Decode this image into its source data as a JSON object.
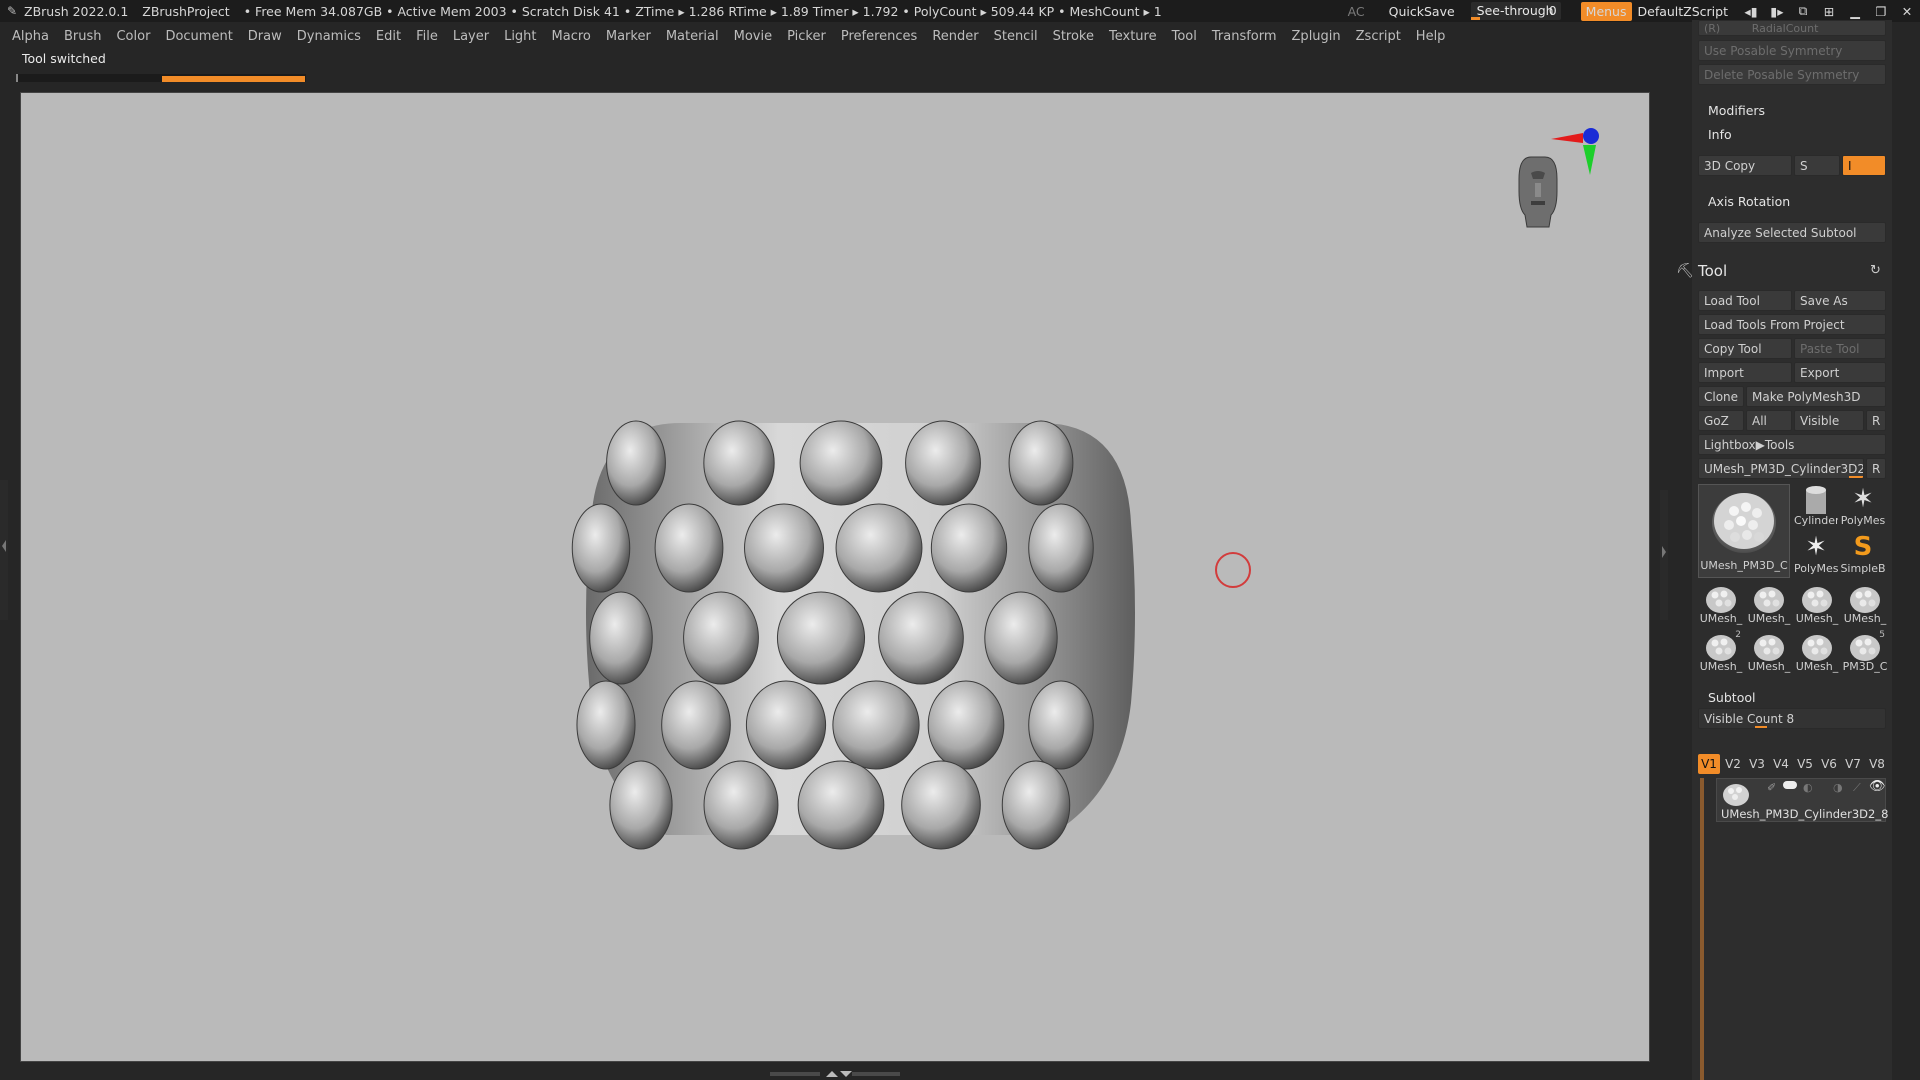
{
  "titlebar": {
    "app": "ZBrush 2022.0.1",
    "project": "ZBrushProject",
    "stats": "• Free Mem 34.087GB • Active Mem 2003 • Scratch Disk 41 • ZTime ▸ 1.286 RTime ▸ 1.89 Timer ▸ 1.792 • PolyCount ▸ 509.44 KP • MeshCount ▸ 1",
    "ac": "AC",
    "quicksave": "QuickSave",
    "see_through_label": "See-through",
    "see_through_value": "0",
    "see_through_fraction": 0.1,
    "menus": "Menus",
    "default_zscript": "DefaultZScript"
  },
  "menubar": [
    "Alpha",
    "Brush",
    "Color",
    "Document",
    "Draw",
    "Dynamics",
    "Edit",
    "File",
    "Layer",
    "Light",
    "Macro",
    "Marker",
    "Material",
    "Movie",
    "Picker",
    "Preferences",
    "Render",
    "Stencil",
    "Stroke",
    "Texture",
    "Tool",
    "Transform",
    "Zplugin",
    "Zscript",
    "Help"
  ],
  "notification": {
    "text": "Tool switched",
    "progress_fraction": 0.5
  },
  "panel": {
    "radial_count": "RadialCount",
    "radial_prefix": "(R)",
    "use_posable_symmetry": "Use Posable Symmetry",
    "delete_posable_symmetry": "Delete Posable Symmetry",
    "modifiers": "Modifiers",
    "info": "Info",
    "copy3d": "3D Copy",
    "copy3d_s": "S",
    "copy3d_i": "I",
    "axis_rotation": "Axis Rotation",
    "analyze": "Analyze Selected Subtool",
    "tool_header": "Tool",
    "load_tool": "Load Tool",
    "save_as": "Save As",
    "load_tools_from_project": "Load Tools From Project",
    "copy_tool": "Copy Tool",
    "paste_tool": "Paste Tool",
    "import": "Import",
    "export": "Export",
    "clone": "Clone",
    "make_polymesh": "Make PolyMesh3D",
    "goz": "GoZ",
    "all": "All",
    "visible": "Visible",
    "r": "R",
    "lightbox_tools": "Lightbox▶Tools",
    "current_tool_name": "UMesh_PM3D_Cylinder3D2_8",
    "current_tool_r": "R",
    "thumbs": {
      "main": "UMesh_PM3D_C",
      "cylinder": "Cylinder",
      "polymesh1": "PolyMes",
      "polymesh2": "PolyMes",
      "simpleb": "SimpleB",
      "row3": [
        "UMesh_",
        "UMesh_",
        "UMesh_",
        "UMesh_"
      ],
      "row4": [
        "UMesh_",
        "UMesh_",
        "UMesh_",
        "PM3D_C"
      ],
      "row4_badges": [
        "2",
        "",
        "",
        "5"
      ]
    },
    "subtool_header": "Subtool",
    "visible_count_label": "Visible Count",
    "visible_count_value": "8",
    "version_tabs": [
      "V1",
      "V2",
      "V3",
      "V4",
      "V5",
      "V6",
      "V7",
      "V8"
    ],
    "subtool_item_name": "UMesh_PM3D_Cylinder3D2_8"
  }
}
